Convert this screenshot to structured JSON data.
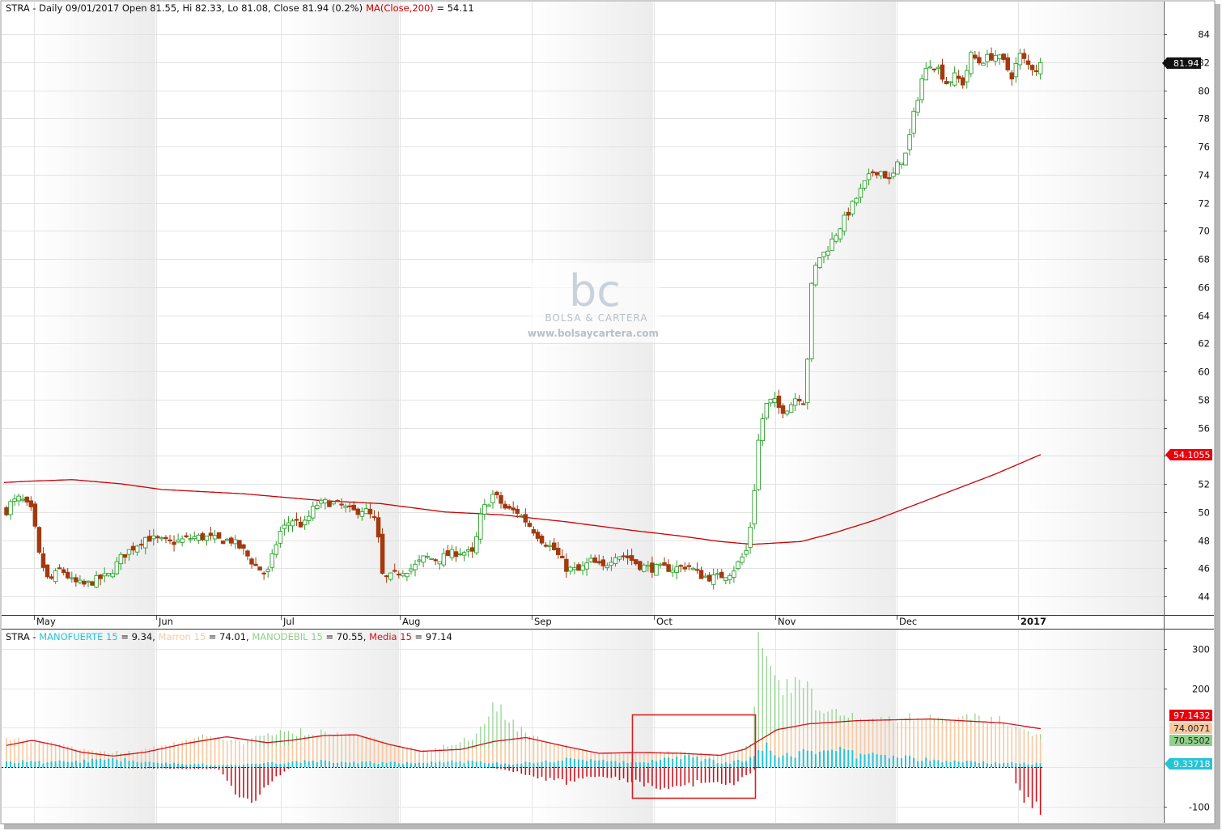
{
  "header": {
    "ticker": "STRA",
    "info": "STRA - Daily 09/01/2017 Open 81.55, Hi 82.33, Lo 81.08, Close 81.94 (0.2%)",
    "ma_label": "MA(Close,200)",
    "ma_value": " = 54.11"
  },
  "lower_header": {
    "prefix": "STRA - ",
    "items": [
      {
        "name": "MANOFUERTE 15",
        "value": " = 9.34, "
      },
      {
        "name": "Marron 15",
        "value": " = 74.01, "
      },
      {
        "name": "MANODEBIL 15",
        "value": " = 70.55, "
      },
      {
        "name": "Media 15",
        "value": " = 97.14"
      }
    ]
  },
  "watermark": {
    "logo": "bc",
    "brand": "BOLSA & CARTERA",
    "url": "www.bolsaycartera.com"
  },
  "colors": {
    "bull": "#2ca02c",
    "bear": "#a33a0f",
    "ma": "#cc0000",
    "manofuerte": "#26c4d6",
    "marron": "#f9c9a0",
    "manodebil": "#8fd18a",
    "media": "#d0101a",
    "highlight_box": "#d82020"
  },
  "badges": {
    "last_price": "81.94",
    "ma_value": "54.1055",
    "media": "97.1432",
    "marron": "74.0071",
    "manodebil": "70.5502",
    "manofuerte": "9.33718"
  },
  "chart_data": [
    {
      "type": "candlestick",
      "title": "STRA - Daily",
      "x_labels": [
        "May",
        "Jun",
        "Jul",
        "Aug",
        "Sep",
        "Oct",
        "Nov",
        "Dec",
        "2017"
      ],
      "y_ticks": [
        44,
        46,
        48,
        50,
        52,
        54,
        56,
        58,
        60,
        62,
        64,
        66,
        68,
        70,
        72,
        74,
        76,
        78,
        80,
        82,
        84
      ],
      "ylim": [
        42.5,
        85.5
      ],
      "last": {
        "date": "09/01/2017",
        "open": 81.55,
        "high": 82.33,
        "low": 81.08,
        "close": 81.94
      },
      "close_path": [
        [
          0,
          48.5
        ],
        [
          10,
          50.5
        ],
        [
          25,
          51.0
        ],
        [
          40,
          50.0
        ],
        [
          48,
          47.0
        ],
        [
          60,
          45.0
        ],
        [
          75,
          46.0
        ],
        [
          90,
          45.0
        ],
        [
          105,
          44.8
        ],
        [
          120,
          45.2
        ],
        [
          135,
          45.5
        ],
        [
          150,
          46.8
        ],
        [
          165,
          47.5
        ],
        [
          180,
          48.2
        ],
        [
          195,
          48.0
        ],
        [
          210,
          47.8
        ],
        [
          225,
          48.0
        ],
        [
          240,
          48.2
        ],
        [
          255,
          48.2
        ],
        [
          270,
          48.0
        ],
        [
          285,
          48.0
        ],
        [
          300,
          47.3
        ],
        [
          315,
          46.2
        ],
        [
          330,
          45.5
        ],
        [
          345,
          48.5
        ],
        [
          360,
          49.5
        ],
        [
          375,
          49.0
        ],
        [
          390,
          50.5
        ],
        [
          405,
          50.7
        ],
        [
          420,
          50.5
        ],
        [
          435,
          50.0
        ],
        [
          450,
          50.2
        ],
        [
          465,
          49.3
        ],
        [
          473,
          45.3
        ],
        [
          480,
          45.3
        ],
        [
          495,
          45.8
        ],
        [
          510,
          46.0
        ],
        [
          525,
          46.8
        ],
        [
          540,
          46.6
        ],
        [
          555,
          47.0
        ],
        [
          570,
          47.2
        ],
        [
          585,
          47.0
        ],
        [
          595,
          50.0
        ],
        [
          610,
          51.3
        ],
        [
          625,
          50.2
        ],
        [
          640,
          50.0
        ],
        [
          655,
          49.0
        ],
        [
          670,
          48.0
        ],
        [
          685,
          47.3
        ],
        [
          700,
          46.0
        ],
        [
          715,
          45.8
        ],
        [
          730,
          46.5
        ],
        [
          745,
          46.0
        ],
        [
          760,
          47.0
        ],
        [
          775,
          46.8
        ],
        [
          790,
          46.2
        ],
        [
          805,
          46.0
        ],
        [
          820,
          46.0
        ],
        [
          835,
          46.0
        ],
        [
          850,
          46.2
        ],
        [
          865,
          45.5
        ],
        [
          880,
          45.3
        ],
        [
          895,
          45.5
        ],
        [
          905,
          45.8
        ],
        [
          915,
          46.6
        ],
        [
          923,
          47.3
        ],
        [
          930,
          50.2
        ],
        [
          937,
          55.0
        ],
        [
          945,
          57.5
        ],
        [
          955,
          58.0
        ],
        [
          965,
          57.2
        ],
        [
          975,
          57.5
        ],
        [
          985,
          58.3
        ],
        [
          995,
          57.8
        ],
        [
          1002,
          65.8
        ],
        [
          1010,
          68.0
        ],
        [
          1020,
          68.5
        ],
        [
          1030,
          69.5
        ],
        [
          1040,
          70.5
        ],
        [
          1050,
          71.5
        ],
        [
          1060,
          72.5
        ],
        [
          1070,
          73.5
        ],
        [
          1080,
          74.3
        ],
        [
          1090,
          74.2
        ],
        [
          1100,
          73.5
        ],
        [
          1110,
          74.8
        ],
        [
          1120,
          75.5
        ],
        [
          1130,
          78.5
        ],
        [
          1140,
          81.0
        ],
        [
          1150,
          82.0
        ],
        [
          1160,
          81.5
        ],
        [
          1170,
          80.5
        ],
        [
          1180,
          81.0
        ],
        [
          1190,
          80.5
        ],
        [
          1200,
          82.5
        ],
        [
          1210,
          82.0
        ],
        [
          1220,
          82.3
        ],
        [
          1230,
          82.5
        ],
        [
          1240,
          82.0
        ],
        [
          1250,
          81.0
        ],
        [
          1260,
          82.5
        ],
        [
          1270,
          81.8
        ],
        [
          1280,
          81.5
        ],
        [
          1287,
          81.9
        ]
      ],
      "ma_path": [
        [
          5,
          52.1
        ],
        [
          40,
          52.2
        ],
        [
          90,
          52.3
        ],
        [
          150,
          52.0
        ],
        [
          200,
          51.6
        ],
        [
          300,
          51.3
        ],
        [
          400,
          50.8
        ],
        [
          470,
          50.6
        ],
        [
          550,
          50.0
        ],
        [
          620,
          49.8
        ],
        [
          700,
          49.3
        ],
        [
          780,
          48.7
        ],
        [
          840,
          48.3
        ],
        [
          890,
          47.9
        ],
        [
          930,
          47.7
        ],
        [
          990,
          47.9
        ],
        [
          1030,
          48.5
        ],
        [
          1080,
          49.4
        ],
        [
          1130,
          50.5
        ],
        [
          1180,
          51.6
        ],
        [
          1230,
          52.7
        ],
        [
          1287,
          54.11
        ]
      ]
    },
    {
      "type": "bar",
      "title": "MANOFUERTE 15, Marron 15, MANODEBIL 15, Media 15",
      "y_ticks": [
        300,
        200,
        -100
      ],
      "ylim": [
        -130,
        330
      ],
      "series": [
        {
          "name": "MANOFUERTE 15",
          "last": 9.34
        },
        {
          "name": "Marron 15",
          "last": 74.01
        },
        {
          "name": "MANODEBIL 15",
          "last": 70.55
        },
        {
          "name": "Media 15",
          "last": 97.14
        }
      ]
    }
  ]
}
